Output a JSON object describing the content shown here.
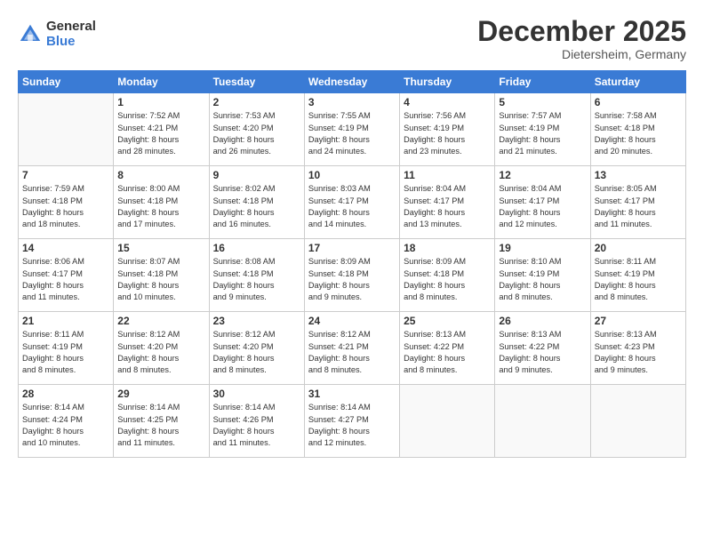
{
  "header": {
    "logo_general": "General",
    "logo_blue": "Blue",
    "month_title": "December 2025",
    "location": "Dietersheim, Germany"
  },
  "days_of_week": [
    "Sunday",
    "Monday",
    "Tuesday",
    "Wednesday",
    "Thursday",
    "Friday",
    "Saturday"
  ],
  "weeks": [
    [
      {
        "num": "",
        "info": ""
      },
      {
        "num": "1",
        "info": "Sunrise: 7:52 AM\nSunset: 4:21 PM\nDaylight: 8 hours\nand 28 minutes."
      },
      {
        "num": "2",
        "info": "Sunrise: 7:53 AM\nSunset: 4:20 PM\nDaylight: 8 hours\nand 26 minutes."
      },
      {
        "num": "3",
        "info": "Sunrise: 7:55 AM\nSunset: 4:19 PM\nDaylight: 8 hours\nand 24 minutes."
      },
      {
        "num": "4",
        "info": "Sunrise: 7:56 AM\nSunset: 4:19 PM\nDaylight: 8 hours\nand 23 minutes."
      },
      {
        "num": "5",
        "info": "Sunrise: 7:57 AM\nSunset: 4:19 PM\nDaylight: 8 hours\nand 21 minutes."
      },
      {
        "num": "6",
        "info": "Sunrise: 7:58 AM\nSunset: 4:18 PM\nDaylight: 8 hours\nand 20 minutes."
      }
    ],
    [
      {
        "num": "7",
        "info": "Sunrise: 7:59 AM\nSunset: 4:18 PM\nDaylight: 8 hours\nand 18 minutes."
      },
      {
        "num": "8",
        "info": "Sunrise: 8:00 AM\nSunset: 4:18 PM\nDaylight: 8 hours\nand 17 minutes."
      },
      {
        "num": "9",
        "info": "Sunrise: 8:02 AM\nSunset: 4:18 PM\nDaylight: 8 hours\nand 16 minutes."
      },
      {
        "num": "10",
        "info": "Sunrise: 8:03 AM\nSunset: 4:17 PM\nDaylight: 8 hours\nand 14 minutes."
      },
      {
        "num": "11",
        "info": "Sunrise: 8:04 AM\nSunset: 4:17 PM\nDaylight: 8 hours\nand 13 minutes."
      },
      {
        "num": "12",
        "info": "Sunrise: 8:04 AM\nSunset: 4:17 PM\nDaylight: 8 hours\nand 12 minutes."
      },
      {
        "num": "13",
        "info": "Sunrise: 8:05 AM\nSunset: 4:17 PM\nDaylight: 8 hours\nand 11 minutes."
      }
    ],
    [
      {
        "num": "14",
        "info": "Sunrise: 8:06 AM\nSunset: 4:17 PM\nDaylight: 8 hours\nand 11 minutes."
      },
      {
        "num": "15",
        "info": "Sunrise: 8:07 AM\nSunset: 4:18 PM\nDaylight: 8 hours\nand 10 minutes."
      },
      {
        "num": "16",
        "info": "Sunrise: 8:08 AM\nSunset: 4:18 PM\nDaylight: 8 hours\nand 9 minutes."
      },
      {
        "num": "17",
        "info": "Sunrise: 8:09 AM\nSunset: 4:18 PM\nDaylight: 8 hours\nand 9 minutes."
      },
      {
        "num": "18",
        "info": "Sunrise: 8:09 AM\nSunset: 4:18 PM\nDaylight: 8 hours\nand 8 minutes."
      },
      {
        "num": "19",
        "info": "Sunrise: 8:10 AM\nSunset: 4:19 PM\nDaylight: 8 hours\nand 8 minutes."
      },
      {
        "num": "20",
        "info": "Sunrise: 8:11 AM\nSunset: 4:19 PM\nDaylight: 8 hours\nand 8 minutes."
      }
    ],
    [
      {
        "num": "21",
        "info": "Sunrise: 8:11 AM\nSunset: 4:19 PM\nDaylight: 8 hours\nand 8 minutes."
      },
      {
        "num": "22",
        "info": "Sunrise: 8:12 AM\nSunset: 4:20 PM\nDaylight: 8 hours\nand 8 minutes."
      },
      {
        "num": "23",
        "info": "Sunrise: 8:12 AM\nSunset: 4:20 PM\nDaylight: 8 hours\nand 8 minutes."
      },
      {
        "num": "24",
        "info": "Sunrise: 8:12 AM\nSunset: 4:21 PM\nDaylight: 8 hours\nand 8 minutes."
      },
      {
        "num": "25",
        "info": "Sunrise: 8:13 AM\nSunset: 4:22 PM\nDaylight: 8 hours\nand 8 minutes."
      },
      {
        "num": "26",
        "info": "Sunrise: 8:13 AM\nSunset: 4:22 PM\nDaylight: 8 hours\nand 9 minutes."
      },
      {
        "num": "27",
        "info": "Sunrise: 8:13 AM\nSunset: 4:23 PM\nDaylight: 8 hours\nand 9 minutes."
      }
    ],
    [
      {
        "num": "28",
        "info": "Sunrise: 8:14 AM\nSunset: 4:24 PM\nDaylight: 8 hours\nand 10 minutes."
      },
      {
        "num": "29",
        "info": "Sunrise: 8:14 AM\nSunset: 4:25 PM\nDaylight: 8 hours\nand 11 minutes."
      },
      {
        "num": "30",
        "info": "Sunrise: 8:14 AM\nSunset: 4:26 PM\nDaylight: 8 hours\nand 11 minutes."
      },
      {
        "num": "31",
        "info": "Sunrise: 8:14 AM\nSunset: 4:27 PM\nDaylight: 8 hours\nand 12 minutes."
      },
      {
        "num": "",
        "info": ""
      },
      {
        "num": "",
        "info": ""
      },
      {
        "num": "",
        "info": ""
      }
    ]
  ]
}
